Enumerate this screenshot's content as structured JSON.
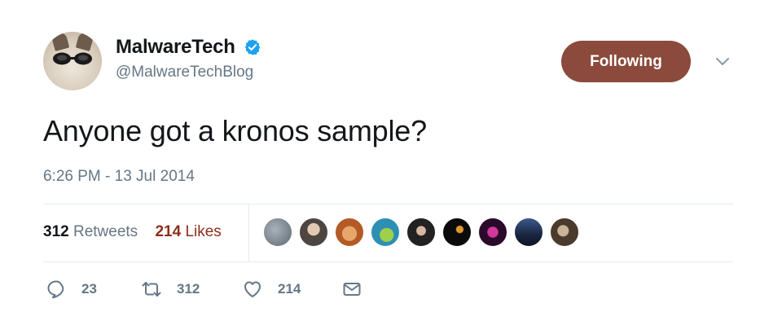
{
  "user": {
    "display_name": "MalwareTech",
    "handle": "@MalwareTechBlog",
    "verified": true,
    "verified_color": "#1da1f2"
  },
  "follow_button": {
    "label": "Following",
    "color": "#8b4a3c"
  },
  "tweet": {
    "text": "Anyone got a kronos sample?",
    "timestamp": "6:26 PM - 13 Jul 2014"
  },
  "stats": {
    "retweets_count": "312",
    "retweets_label": "Retweets",
    "likes_count": "214",
    "likes_label": "Likes"
  },
  "likers": [
    {
      "icon": "liker-avatar-1",
      "color": "#7d8a94"
    },
    {
      "icon": "liker-avatar-2",
      "color": "#9a8f86"
    },
    {
      "icon": "liker-avatar-3",
      "color": "#c7743f"
    },
    {
      "icon": "liker-avatar-4",
      "color": "#3aa9c9"
    },
    {
      "icon": "liker-avatar-5",
      "color": "#2b2b2b"
    },
    {
      "icon": "liker-avatar-6",
      "color": "#111111"
    },
    {
      "icon": "liker-avatar-7",
      "color": "#3a0d3a"
    },
    {
      "icon": "liker-avatar-8",
      "color": "#1d2b4a"
    },
    {
      "icon": "liker-avatar-9",
      "color": "#6b5844"
    }
  ],
  "actions": {
    "reply_count": "23",
    "retweet_count": "312",
    "like_count": "214"
  }
}
